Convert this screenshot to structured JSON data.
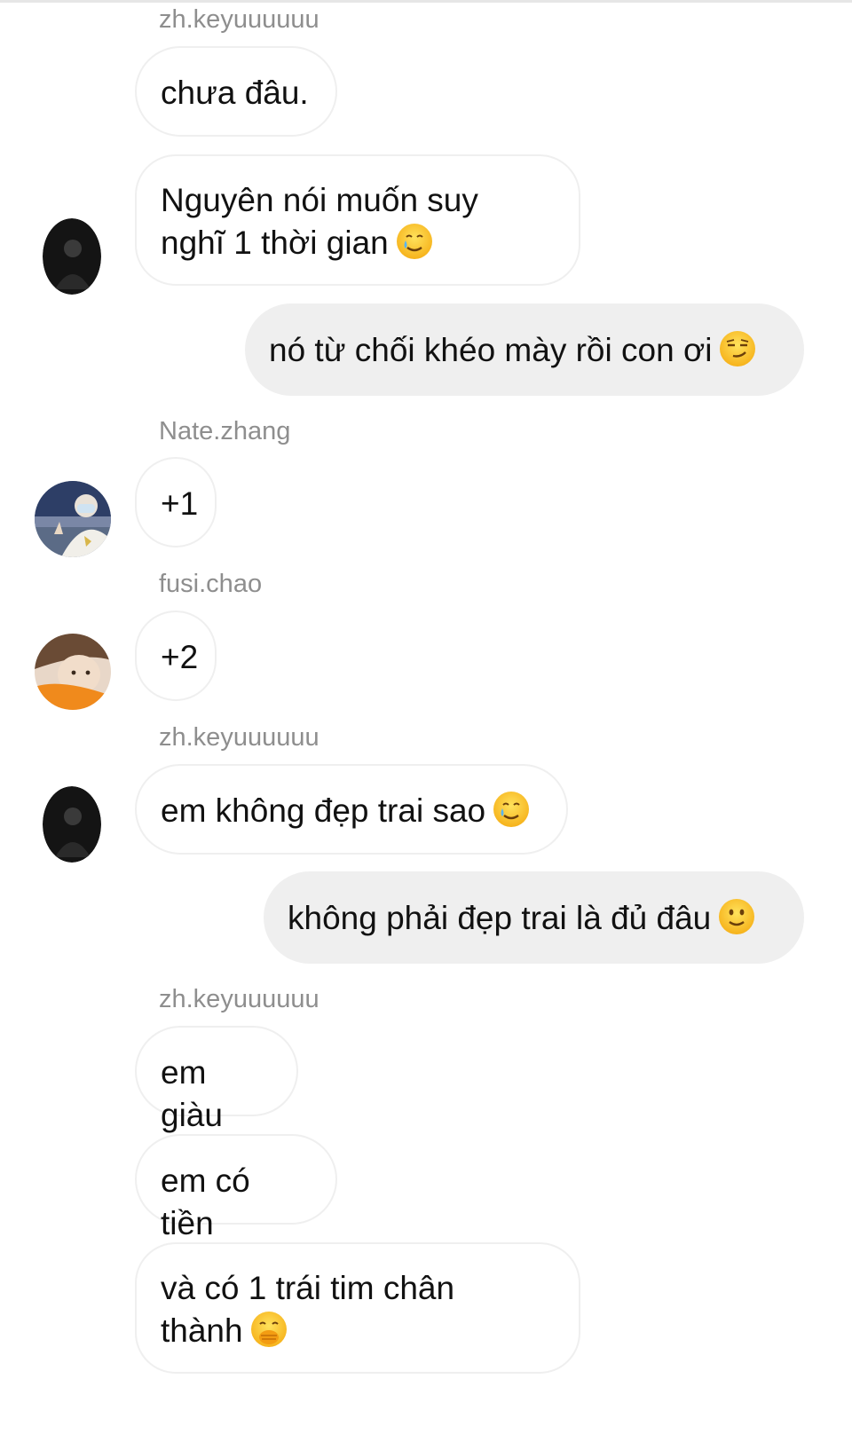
{
  "conversation": {
    "name_1": "zh.keyuuuuuu",
    "msg_1": "chưa đâu.",
    "msg_2_line1": "Nguyên nói muốn suy",
    "msg_2_line2": "nghĩ 1 thời gian",
    "msg_3": "nó từ chối khéo mày rồi con ơi",
    "name_2": "Nate.zhang",
    "msg_4": "+1",
    "name_3": "fusi.chao",
    "msg_5": "+2",
    "name_4": "zh.keyuuuuuu",
    "msg_6": "em không đẹp trai sao",
    "msg_7": "không phải đẹp trai là đủ đâu",
    "name_5": "zh.keyuuuuuu",
    "msg_8": "em giàu",
    "msg_9": "em có tiền",
    "msg_10_line1": "và có 1 trái tim chân",
    "msg_10_line2": "thành"
  },
  "icons": {
    "msg_2_emoji": "smiling-face-with-tear-emoji",
    "msg_3_emoji": "smirking-face-emoji",
    "msg_6_emoji": "smiling-face-with-tear-emoji",
    "msg_7_emoji": "slightly-smiling-face-emoji",
    "msg_10_emoji": "face-with-hand-over-mouth-emoji"
  },
  "colors": {
    "incoming_bubble_border": "#efefef",
    "outgoing_bubble_bg": "#efefef",
    "username_text": "#8e8e8e"
  }
}
